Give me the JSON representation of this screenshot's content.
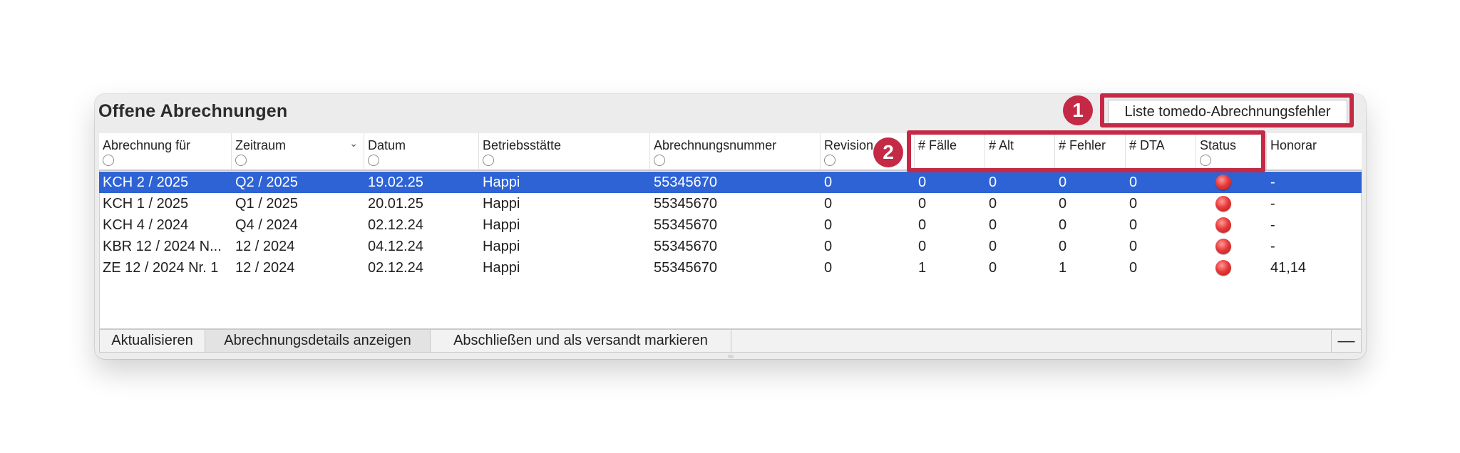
{
  "window": {
    "title": "Offene Abrechnungen",
    "error_list_button": "Liste tomedo-Abrechnungsfehler"
  },
  "annotations": {
    "badge1": "1",
    "badge2": "2",
    "highlight_color": "#c42945"
  },
  "table": {
    "columns": [
      "Abrechnung für",
      "Zeitraum",
      "Datum",
      "Betriebsstätte",
      "Abrechnungsnummer",
      "Revision",
      "# Fälle",
      "# Alt",
      "# Fehler",
      "# DTA",
      "Status",
      "Honorar"
    ],
    "sorted_column": "Zeitraum",
    "rows": [
      [
        "KCH 2 / 2025",
        "Q2 / 2025",
        "19.02.25",
        "Happi",
        "55345670",
        "0",
        "0",
        "0",
        "0",
        "0",
        "red",
        "-"
      ],
      [
        "KCH 1 / 2025",
        "Q1 / 2025",
        "20.01.25",
        "Happi",
        "55345670",
        "0",
        "0",
        "0",
        "0",
        "0",
        "red",
        "-"
      ],
      [
        "KCH 4 / 2024",
        "Q4 / 2024",
        "02.12.24",
        "Happi",
        "55345670",
        "0",
        "0",
        "0",
        "0",
        "0",
        "red",
        "-"
      ],
      [
        "KBR 12 / 2024 N...",
        "12 / 2024",
        "04.12.24",
        "Happi",
        "55345670",
        "0",
        "0",
        "0",
        "0",
        "0",
        "red",
        "-"
      ],
      [
        "ZE 12 / 2024 Nr. 1",
        "12 / 2024",
        "02.12.24",
        "Happi",
        "55345670",
        "0",
        "1",
        "0",
        "1",
        "0",
        "red",
        "41,14"
      ]
    ],
    "selected_row": 0,
    "selection_color": "#2e63d6",
    "status_color": "#e83b3b"
  },
  "footer": {
    "refresh": "Aktualisieren",
    "details": "Abrechnungsdetails anzeigen",
    "close": "Abschließen und als versandt markieren",
    "minus": "—"
  }
}
